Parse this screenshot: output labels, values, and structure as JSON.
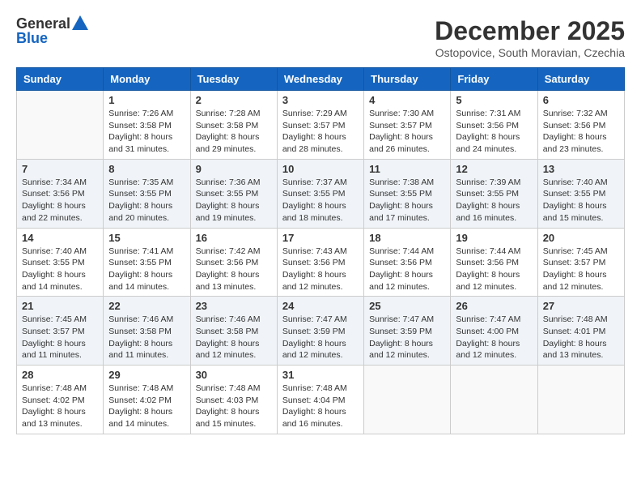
{
  "header": {
    "logo_general": "General",
    "logo_blue": "Blue",
    "month": "December 2025",
    "location": "Ostopovice, South Moravian, Czechia"
  },
  "days_of_week": [
    "Sunday",
    "Monday",
    "Tuesday",
    "Wednesday",
    "Thursday",
    "Friday",
    "Saturday"
  ],
  "weeks": [
    [
      {
        "day": "",
        "info": ""
      },
      {
        "day": "1",
        "info": "Sunrise: 7:26 AM\nSunset: 3:58 PM\nDaylight: 8 hours\nand 31 minutes."
      },
      {
        "day": "2",
        "info": "Sunrise: 7:28 AM\nSunset: 3:58 PM\nDaylight: 8 hours\nand 29 minutes."
      },
      {
        "day": "3",
        "info": "Sunrise: 7:29 AM\nSunset: 3:57 PM\nDaylight: 8 hours\nand 28 minutes."
      },
      {
        "day": "4",
        "info": "Sunrise: 7:30 AM\nSunset: 3:57 PM\nDaylight: 8 hours\nand 26 minutes."
      },
      {
        "day": "5",
        "info": "Sunrise: 7:31 AM\nSunset: 3:56 PM\nDaylight: 8 hours\nand 24 minutes."
      },
      {
        "day": "6",
        "info": "Sunrise: 7:32 AM\nSunset: 3:56 PM\nDaylight: 8 hours\nand 23 minutes."
      }
    ],
    [
      {
        "day": "7",
        "info": "Sunrise: 7:34 AM\nSunset: 3:56 PM\nDaylight: 8 hours\nand 22 minutes."
      },
      {
        "day": "8",
        "info": "Sunrise: 7:35 AM\nSunset: 3:55 PM\nDaylight: 8 hours\nand 20 minutes."
      },
      {
        "day": "9",
        "info": "Sunrise: 7:36 AM\nSunset: 3:55 PM\nDaylight: 8 hours\nand 19 minutes."
      },
      {
        "day": "10",
        "info": "Sunrise: 7:37 AM\nSunset: 3:55 PM\nDaylight: 8 hours\nand 18 minutes."
      },
      {
        "day": "11",
        "info": "Sunrise: 7:38 AM\nSunset: 3:55 PM\nDaylight: 8 hours\nand 17 minutes."
      },
      {
        "day": "12",
        "info": "Sunrise: 7:39 AM\nSunset: 3:55 PM\nDaylight: 8 hours\nand 16 minutes."
      },
      {
        "day": "13",
        "info": "Sunrise: 7:40 AM\nSunset: 3:55 PM\nDaylight: 8 hours\nand 15 minutes."
      }
    ],
    [
      {
        "day": "14",
        "info": "Sunrise: 7:40 AM\nSunset: 3:55 PM\nDaylight: 8 hours\nand 14 minutes."
      },
      {
        "day": "15",
        "info": "Sunrise: 7:41 AM\nSunset: 3:55 PM\nDaylight: 8 hours\nand 14 minutes."
      },
      {
        "day": "16",
        "info": "Sunrise: 7:42 AM\nSunset: 3:56 PM\nDaylight: 8 hours\nand 13 minutes."
      },
      {
        "day": "17",
        "info": "Sunrise: 7:43 AM\nSunset: 3:56 PM\nDaylight: 8 hours\nand 12 minutes."
      },
      {
        "day": "18",
        "info": "Sunrise: 7:44 AM\nSunset: 3:56 PM\nDaylight: 8 hours\nand 12 minutes."
      },
      {
        "day": "19",
        "info": "Sunrise: 7:44 AM\nSunset: 3:56 PM\nDaylight: 8 hours\nand 12 minutes."
      },
      {
        "day": "20",
        "info": "Sunrise: 7:45 AM\nSunset: 3:57 PM\nDaylight: 8 hours\nand 12 minutes."
      }
    ],
    [
      {
        "day": "21",
        "info": "Sunrise: 7:45 AM\nSunset: 3:57 PM\nDaylight: 8 hours\nand 11 minutes."
      },
      {
        "day": "22",
        "info": "Sunrise: 7:46 AM\nSunset: 3:58 PM\nDaylight: 8 hours\nand 11 minutes."
      },
      {
        "day": "23",
        "info": "Sunrise: 7:46 AM\nSunset: 3:58 PM\nDaylight: 8 hours\nand 12 minutes."
      },
      {
        "day": "24",
        "info": "Sunrise: 7:47 AM\nSunset: 3:59 PM\nDaylight: 8 hours\nand 12 minutes."
      },
      {
        "day": "25",
        "info": "Sunrise: 7:47 AM\nSunset: 3:59 PM\nDaylight: 8 hours\nand 12 minutes."
      },
      {
        "day": "26",
        "info": "Sunrise: 7:47 AM\nSunset: 4:00 PM\nDaylight: 8 hours\nand 12 minutes."
      },
      {
        "day": "27",
        "info": "Sunrise: 7:48 AM\nSunset: 4:01 PM\nDaylight: 8 hours\nand 13 minutes."
      }
    ],
    [
      {
        "day": "28",
        "info": "Sunrise: 7:48 AM\nSunset: 4:02 PM\nDaylight: 8 hours\nand 13 minutes."
      },
      {
        "day": "29",
        "info": "Sunrise: 7:48 AM\nSunset: 4:02 PM\nDaylight: 8 hours\nand 14 minutes."
      },
      {
        "day": "30",
        "info": "Sunrise: 7:48 AM\nSunset: 4:03 PM\nDaylight: 8 hours\nand 15 minutes."
      },
      {
        "day": "31",
        "info": "Sunrise: 7:48 AM\nSunset: 4:04 PM\nDaylight: 8 hours\nand 16 minutes."
      },
      {
        "day": "",
        "info": ""
      },
      {
        "day": "",
        "info": ""
      },
      {
        "day": "",
        "info": ""
      }
    ]
  ]
}
